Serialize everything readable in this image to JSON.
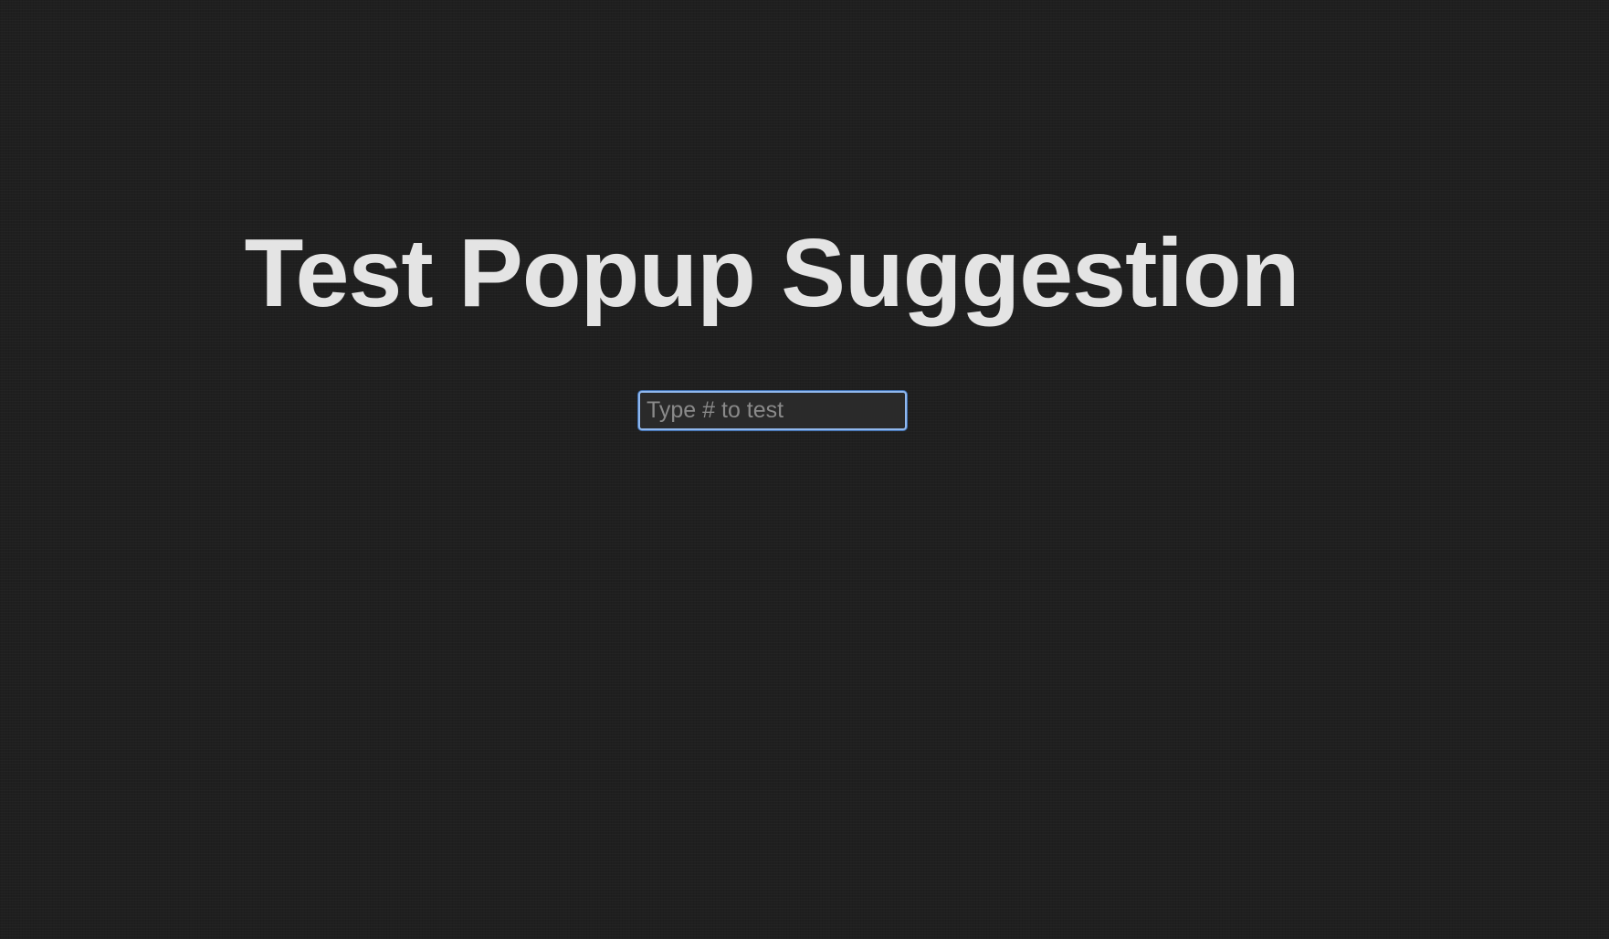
{
  "page": {
    "title": "Test Popup Suggestion"
  },
  "input": {
    "placeholder": "Type # to test",
    "value": ""
  },
  "colors": {
    "background": "#1f1f1f",
    "title_text": "#e4e4e4",
    "input_focus_border": "#90b8ee",
    "placeholder_text": "#8a8a8a"
  }
}
